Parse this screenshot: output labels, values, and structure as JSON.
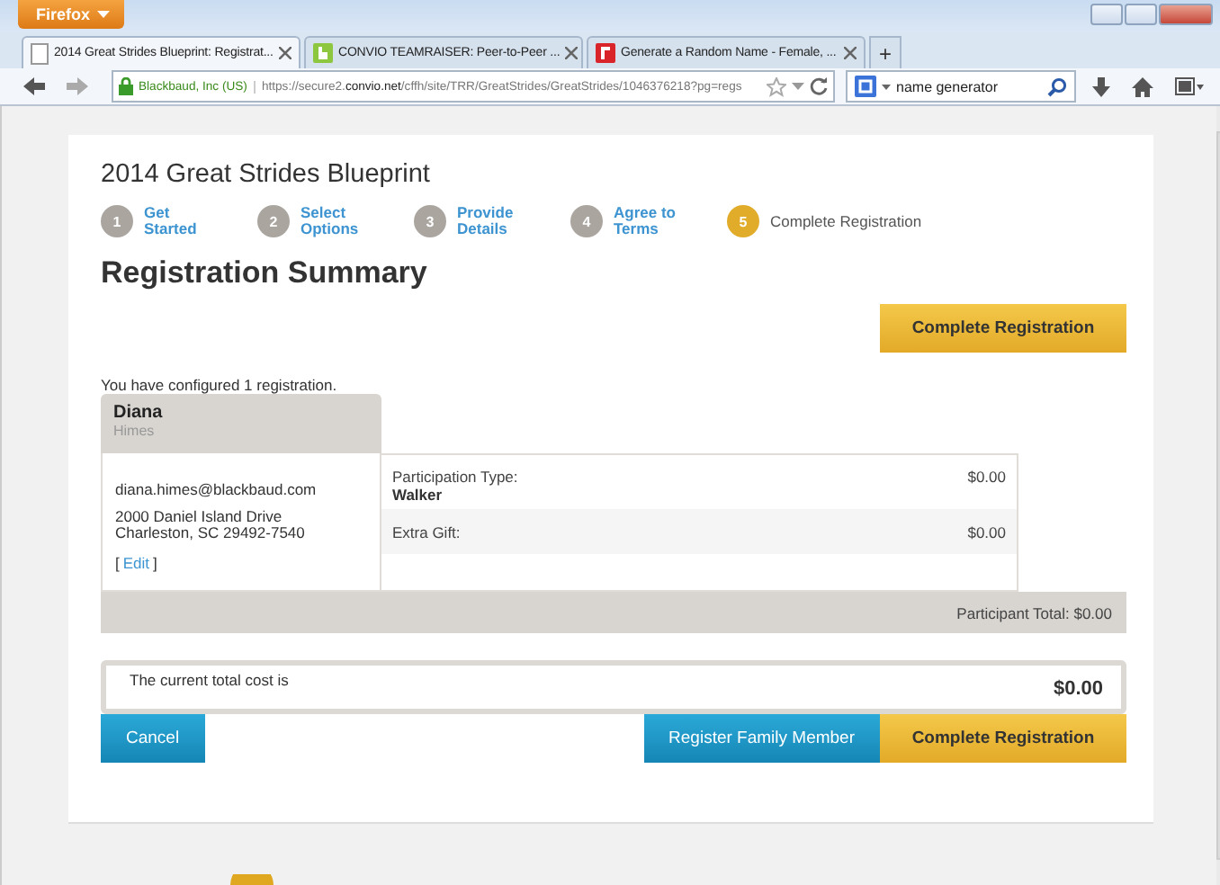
{
  "browser": {
    "app_button": "Firefox",
    "tabs": [
      {
        "title": "2014 Great Strides Blueprint: Registrat...",
        "selected": true
      },
      {
        "title": "CONVIO TEAMRAISER: Peer-to-Peer ...",
        "selected": false
      },
      {
        "title": "Generate a Random Name - Female, ...",
        "selected": false
      }
    ],
    "new_tab": "+",
    "site_identity": "Blackbaud, Inc (US)",
    "url": "https://secure2.**convio.net**/cffh/site/TRR/GreatStrides/GreatStrides/1046376218?pg=regs",
    "search_value": "name generator"
  },
  "page": {
    "title": "2014 Great Strides Blueprint",
    "steps": [
      {
        "number": "1",
        "label": "Get Started",
        "selected": false
      },
      {
        "number": "2",
        "label": "Select Options",
        "selected": false
      },
      {
        "number": "3",
        "label": "Provide Details",
        "selected": false
      },
      {
        "number": "4",
        "label": "Agree to Terms",
        "selected": false
      },
      {
        "number": "5",
        "label": "Complete Registration",
        "selected": true
      }
    ],
    "heading": "Registration Summary",
    "top_button": "Complete Registration",
    "configured_text": "You have configured 1 registration.",
    "participant": {
      "first_name": "Diana",
      "last_name": "Himes",
      "email": "diana.himes@blackbaud.com",
      "address_lines": [
        "2000 Daniel Island Drive",
        "Charleston, SC 29492-7540"
      ],
      "edit": {
        "open": "[",
        "link": "Edit",
        "close": "]"
      }
    },
    "line_items": [
      {
        "label": "Participation Type:",
        "value": "Walker",
        "amount": "$0.00"
      },
      {
        "label": "Extra Gift:",
        "amount": "$0.00"
      }
    ],
    "participant_total": "Participant Total: $0.00",
    "total": {
      "label": "The current total cost is",
      "amount": "$0.00"
    },
    "buttons": [
      {
        "label": "Cancel",
        "kind": "blue"
      },
      {
        "label": "Register Family Member",
        "kind": "blue"
      },
      {
        "label": "Complete Registration",
        "kind": "gold"
      }
    ]
  }
}
